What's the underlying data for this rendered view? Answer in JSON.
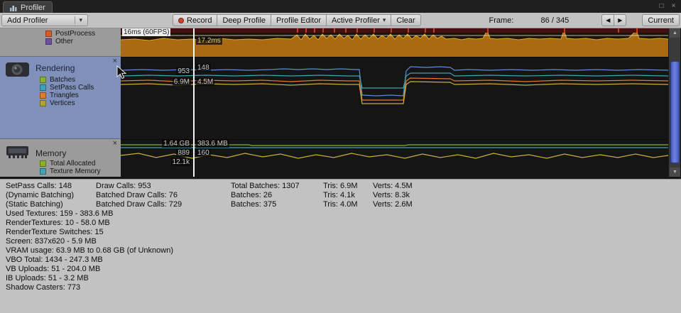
{
  "window": {
    "title": "Profiler"
  },
  "window_controls": {
    "maximize": "□",
    "close": "×"
  },
  "icons": {
    "chevron_down": "▾",
    "scroll_up": "▲",
    "scroll_down": "▼"
  },
  "toolbar": {
    "add_profiler": "Add Profiler",
    "record": "Record",
    "deep_profile": "Deep Profile",
    "profile_editor": "Profile Editor",
    "active_profiler": "Active Profiler",
    "clear": "Clear",
    "frame_label": "Frame:",
    "frame_value": "86 / 345",
    "prev_frame": "◀",
    "next_frame": "▶",
    "current": "Current"
  },
  "modules": {
    "close_glyph": "×",
    "cpu_partial": {
      "legend": [
        {
          "label": "PostProcess",
          "color": "#d75c28"
        },
        {
          "label": "Other",
          "color": "#6e4fa0"
        }
      ]
    },
    "rendering": {
      "title": "Rendering",
      "legend": [
        {
          "label": "Batches",
          "color": "#88b22a"
        },
        {
          "label": "SetPass Calls",
          "color": "#3fa3b5"
        },
        {
          "label": "Triangles",
          "color": "#e07a2c"
        },
        {
          "label": "Vertices",
          "color": "#b2a22e"
        }
      ]
    },
    "memory": {
      "title": "Memory",
      "legend": [
        {
          "label": "Total Allocated",
          "color": "#88b22a"
        },
        {
          "label": "Texture Memory",
          "color": "#3fa3b5"
        }
      ]
    }
  },
  "charts": {
    "cpu": {
      "target_label": "16ms (60FPS)",
      "current_label": "17.2ms"
    },
    "rendering": {
      "peak_draw_calls": "953",
      "current_setpass": "148",
      "peak_tris": "6.9M",
      "current_verts": "4.5M"
    },
    "memory": {
      "row1_left": "1.64 GB",
      "row1_right": "383.6 MB",
      "row2_left": "889",
      "row2_right": "160",
      "row3_left": "12.1k"
    }
  },
  "colors": {
    "selection_blue": "#7f90ba",
    "scrollbar_thumb": "#5068c8",
    "frame_line": "#ffffff",
    "cpu_area": "#a96a12"
  },
  "stats": {
    "rows": [
      [
        "SetPass Calls: 148",
        "Draw Calls: 953",
        "Total Batches: 1307",
        "Tris: 6.9M",
        "Verts: 4.5M"
      ],
      [
        "(Dynamic Batching)",
        "Batched Draw Calls: 76",
        "Batches: 26",
        "Tris: 4.1k",
        "Verts: 8.3k"
      ],
      [
        "(Static Batching)",
        "Batched Draw Calls: 729",
        "Batches: 375",
        "Tris: 4.0M",
        "Verts: 2.6M"
      ]
    ],
    "lines": [
      "Used Textures: 159 - 383.6 MB",
      "RenderTextures: 10 - 58.0 MB",
      "RenderTexture Switches: 15",
      "Screen: 837x620 - 5.9 MB",
      "VRAM usage: 63.9 MB to 0.68 GB (of Unknown)",
      "VBO Total: 1434 - 247.3 MB",
      "VB Uploads: 51 - 204.0 MB",
      "IB Uploads: 51 - 3.2 MB",
      "Shadow Casters: 773"
    ]
  }
}
